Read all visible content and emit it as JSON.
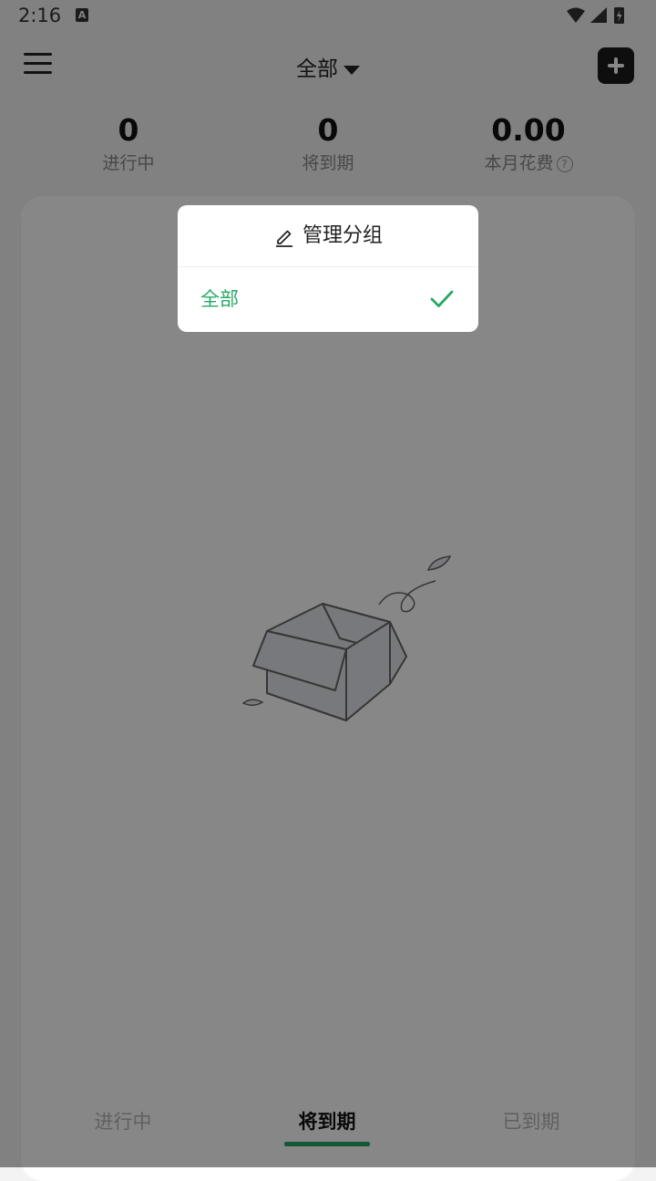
{
  "status_bar": {
    "time": "2:16",
    "notification_icon": "A"
  },
  "header": {
    "group_label": "全部",
    "menu_icon": "hamburger-icon",
    "add_icon": "plus-icon"
  },
  "stats": [
    {
      "value": "0",
      "label": "进行中"
    },
    {
      "value": "0",
      "label": "将到期"
    },
    {
      "value": "0.00",
      "label": "本月花费"
    }
  ],
  "tabs": [
    {
      "label": "进行中",
      "active": false
    },
    {
      "label": "将到期",
      "active": true
    },
    {
      "label": "已到期",
      "active": false
    }
  ],
  "popup": {
    "manage_label": "管理分组",
    "items": [
      {
        "label": "全部",
        "selected": true
      }
    ]
  },
  "colors": {
    "accent": "#27a865",
    "overlay": "rgba(0,0,0,0.47)"
  }
}
